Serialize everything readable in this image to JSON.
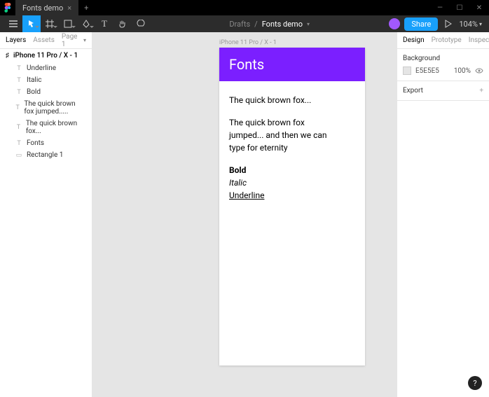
{
  "titlebar": {
    "tab_name": "Fonts demo"
  },
  "toolbar": {
    "breadcrumb_folder": "Drafts",
    "breadcrumb_doc": "Fonts demo",
    "share_label": "Share",
    "zoom": "104%"
  },
  "leftpanel": {
    "tabs": {
      "layers": "Layers",
      "assets": "Assets",
      "page": "Page 1"
    },
    "frame_root": "iPhone 11 Pro / X - 1",
    "layers": [
      "Underline",
      "Italic",
      "Bold",
      "The quick brown fox jumped.....",
      "The quick brown fox...",
      "Fonts",
      "Rectangle 1"
    ]
  },
  "canvas": {
    "frame_label": "iPhone 11 Pro / X - 1",
    "header_text": "Fonts",
    "line1": "The quick brown fox...",
    "line2": "The quick brown fox jumped... and then we can type for eternity",
    "bold": "Bold",
    "italic": "Italic",
    "underline": "Underline"
  },
  "rightpanel": {
    "tabs": {
      "design": "Design",
      "prototype": "Prototype",
      "inspect": "Inspect"
    },
    "background_label": "Background",
    "background_hex": "E5E5E5",
    "background_pct": "100%",
    "export_label": "Export"
  },
  "help": "?"
}
